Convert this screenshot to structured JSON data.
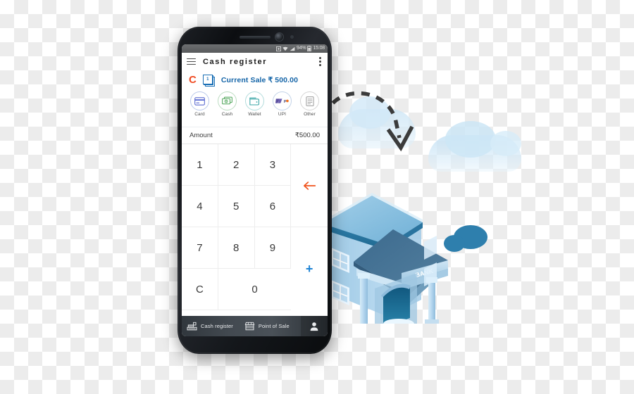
{
  "phone": {
    "status_bar": {
      "time": "15:08",
      "battery_text": "94%",
      "icons": [
        "alarm-icon",
        "wifi-icon",
        "signal-icon",
        "battery-icon"
      ]
    },
    "app_bar": {
      "menu_icon": "hamburger-menu-icon",
      "title": "Cash register",
      "overflow_icon": "overflow-menu-icon"
    },
    "current_sale": {
      "clear_label": "C",
      "badge_count": "1",
      "badge_icon": "stacked-cards-icon",
      "label": "Current Sale ₹ 500.00"
    },
    "payment_methods": [
      {
        "label": "Card",
        "icon": "credit-card-icon",
        "color": "#5b6bd1"
      },
      {
        "label": "Cash",
        "icon": "banknotes-icon",
        "color": "#4aa355"
      },
      {
        "label": "Wallet",
        "icon": "wallet-icon",
        "color": "#3aa6a6"
      },
      {
        "label": "UPI",
        "icon": "upi-logo-icon",
        "color": "#f2711c"
      },
      {
        "label": "Other",
        "icon": "document-icon",
        "color": "#9a9a9a"
      }
    ],
    "amount_row": {
      "label": "Amount",
      "value": "₹500.00"
    },
    "keypad": {
      "keys": [
        "1",
        "2",
        "3",
        "4",
        "5",
        "6",
        "7",
        "8",
        "9"
      ],
      "clear_key": "C",
      "zero_key": "0",
      "backspace_icon": "backspace-arrow-icon",
      "plus_label": "+",
      "backspace_color": "#f0531c",
      "plus_color": "#1d83d4"
    },
    "bottom_nav": [
      {
        "label": "Cash register",
        "icon": "cash-register-icon"
      },
      {
        "label": "Point of Sale",
        "icon": "storefront-icon"
      }
    ],
    "profile_icon": "user-avatar-icon"
  },
  "illustration": {
    "bank_sign_text": "BANK",
    "arrow_icon": "dashed-curved-arrow-icon",
    "colors": {
      "roof_light": "#a9d3ea",
      "roof_dark": "#3f6f92",
      "wall": "#bedcf0",
      "door": "#1b6c96",
      "bush": "#2e7fad"
    }
  }
}
